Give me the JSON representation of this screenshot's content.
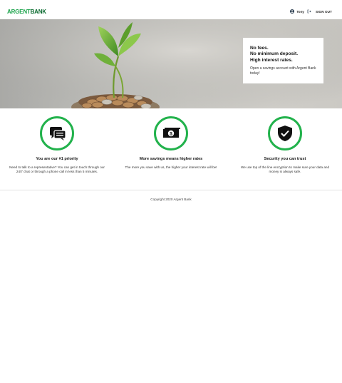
{
  "brand": {
    "part1": "ARGENT",
    "part2": "BANK",
    "color_light": "#1aa34a",
    "color_dark": "#0b6b30"
  },
  "header": {
    "user_icon": "user-circle-icon",
    "user_name": "Tony",
    "signout_icon": "sign-out-icon",
    "signout_label": "SIGN OUT"
  },
  "hero": {
    "headline": [
      "No fees.",
      "No minimum deposit.",
      "High interest rates."
    ],
    "subtext": "Open a savings account with Argent Bank today!"
  },
  "features": [
    {
      "icon": "chat-icon",
      "title": "You are our #1 priority",
      "text": "Need to talk to a representative? You can get in touch through our 24/7 chat or through a phone call in less than 5 minutes."
    },
    {
      "icon": "money-icon",
      "title": "More savings means higher rates",
      "text": "The more you save with us, the higher your interest rate will be!"
    },
    {
      "icon": "shield-icon",
      "title": "Security you can trust",
      "text": "We use top of the line encryption to make sure your data and money is always safe."
    }
  ],
  "footer": {
    "copyright": "Copyright 2020 Argent Bank"
  },
  "accent_color": "#22b24c"
}
